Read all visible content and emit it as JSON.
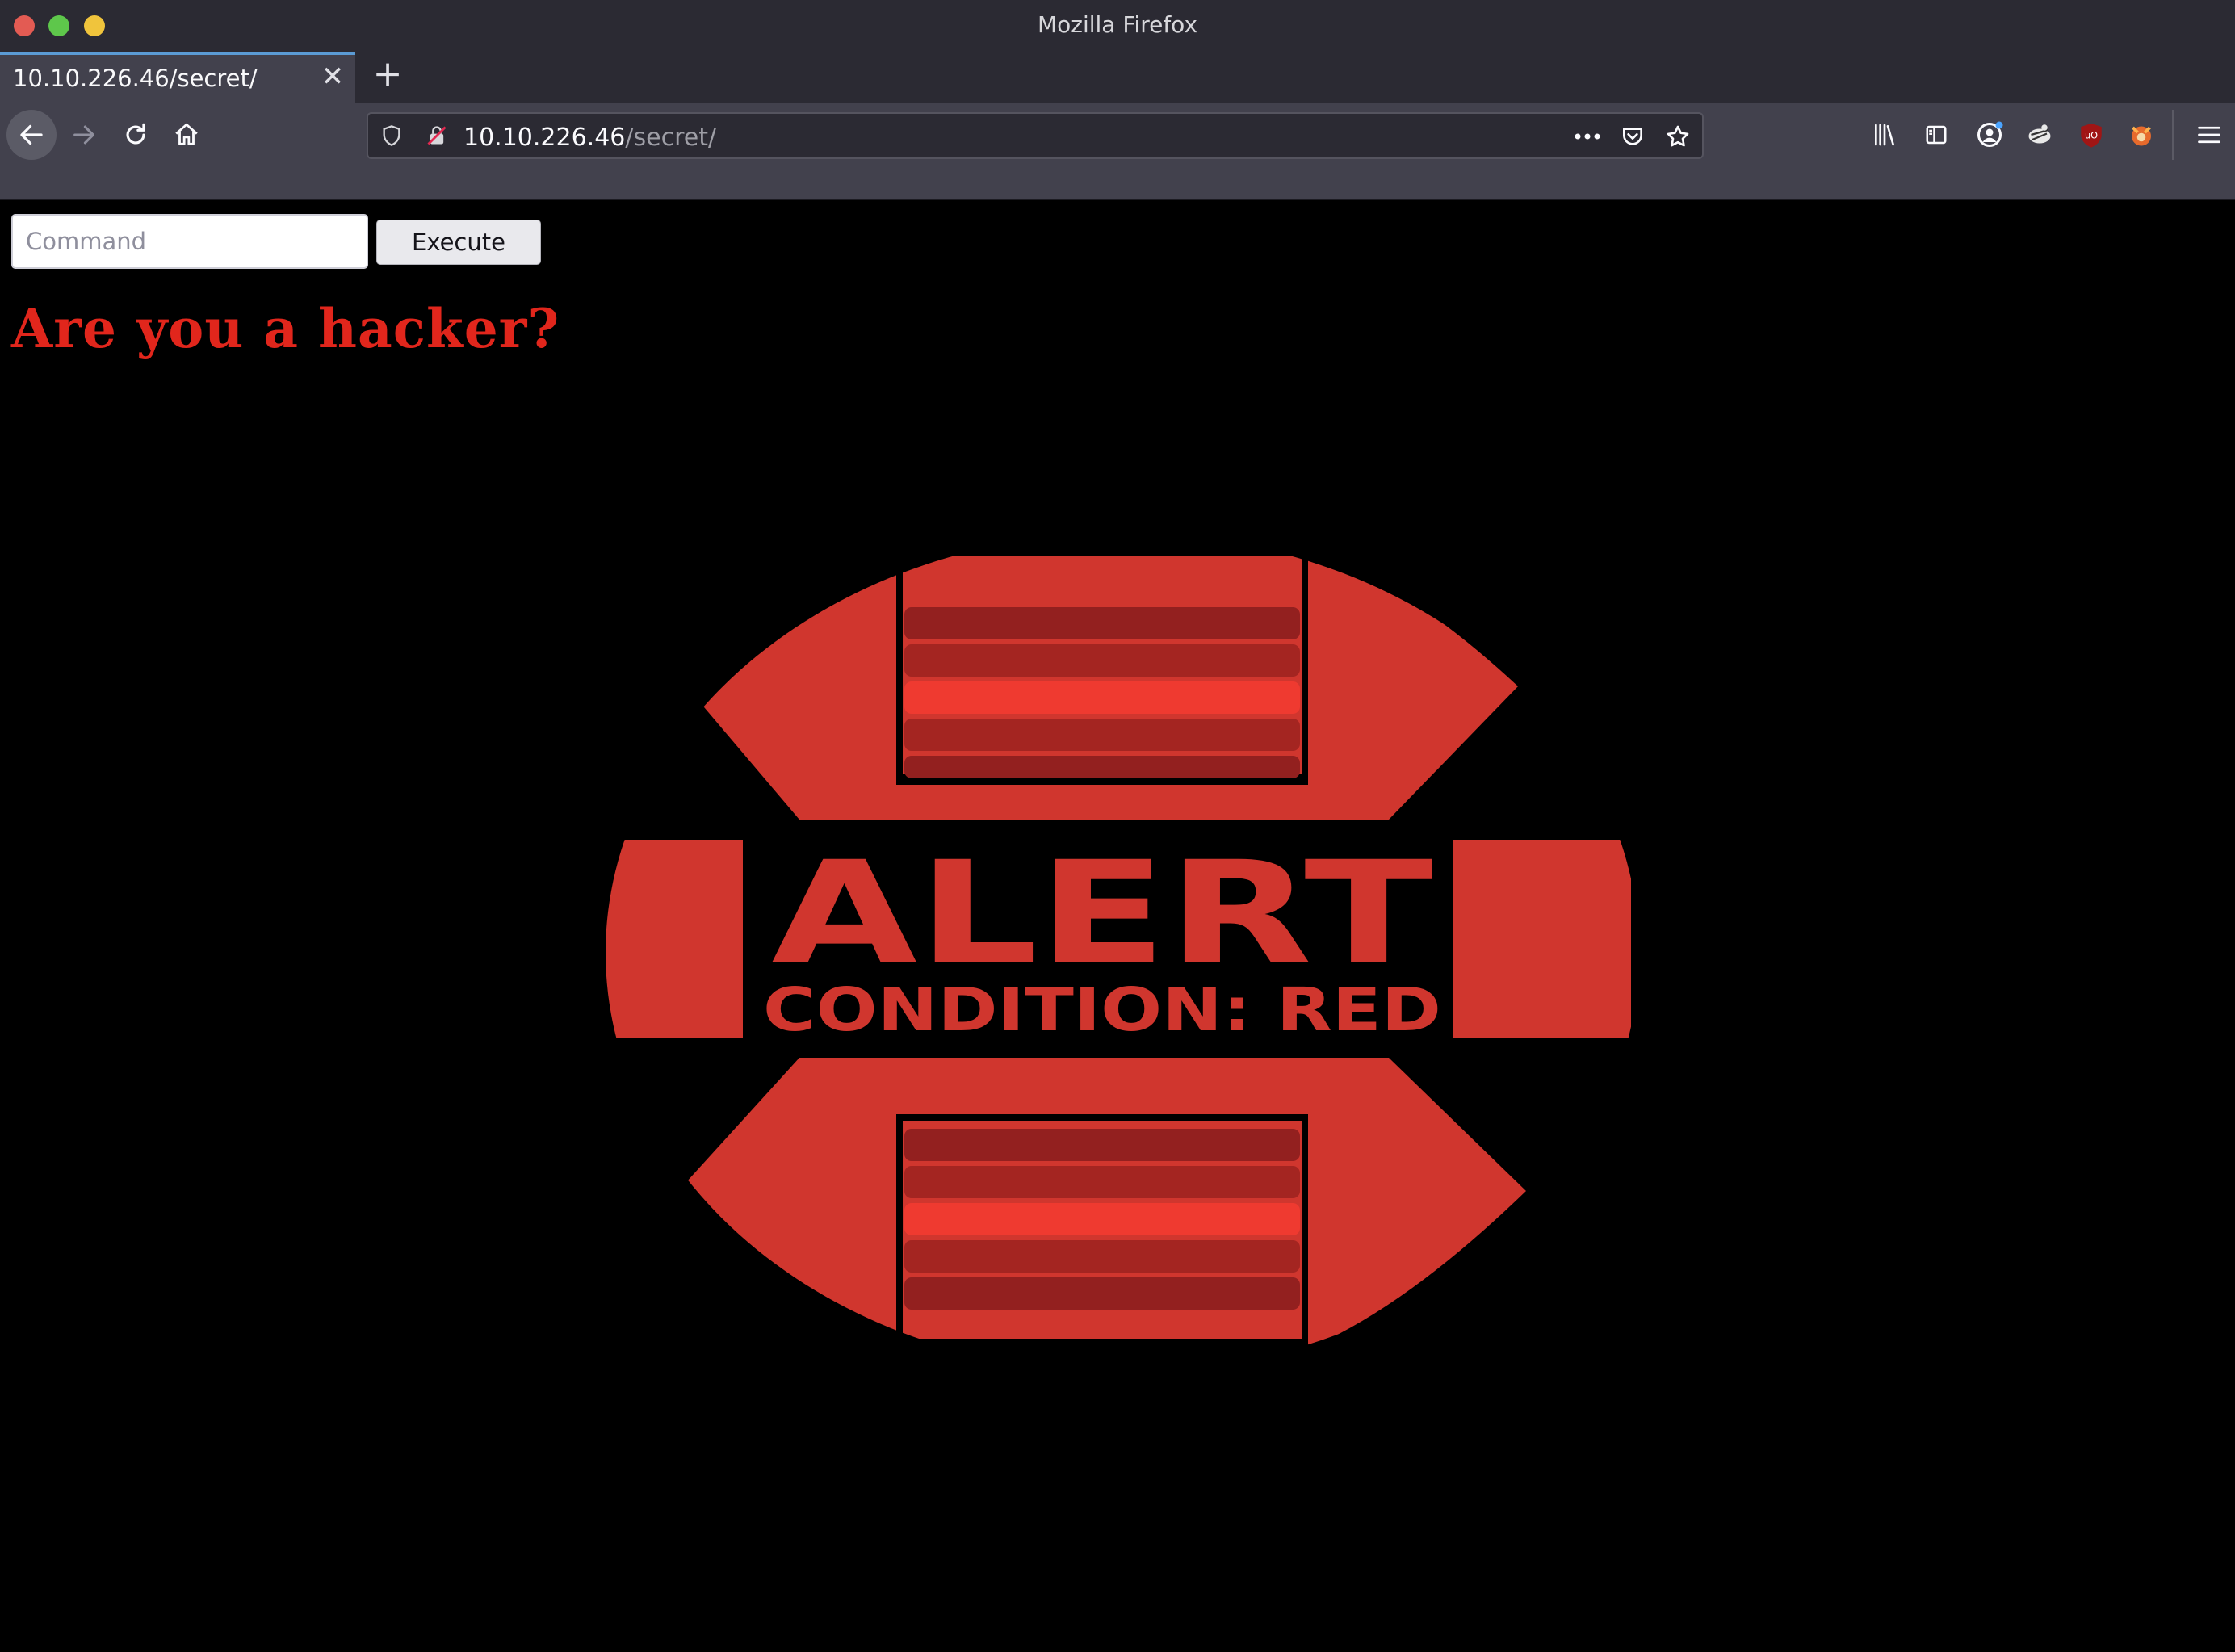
{
  "window": {
    "title": "Mozilla Firefox"
  },
  "tab": {
    "title": "10.10.226.46/secret/",
    "close_icon": "close-icon",
    "new_tab_icon": "plus-icon"
  },
  "navbar": {
    "url_host": "10.10.226.46",
    "url_path": "/secret/",
    "icons": [
      "back-arrow-icon",
      "forward-arrow-icon",
      "reload-icon",
      "home-icon",
      "shield-icon",
      "insecure-lock-icon",
      "more-dots-icon",
      "pocket-icon",
      "bookmark-star-icon",
      "library-icon",
      "sidebar-icon",
      "account-icon",
      "extension-icon",
      "ublock-icon",
      "fox-extension-icon",
      "hamburger-menu-icon"
    ]
  },
  "page": {
    "command_placeholder": "Command",
    "execute_label": "Execute",
    "heading": "Are you a hacker?",
    "logo": {
      "line1": "ALERT",
      "line2": "CONDITION: RED"
    }
  },
  "colors": {
    "alert_red": "#d0362e",
    "stripe_dark": "#93201f",
    "heading_red": "#e1261c",
    "page_bg": "#000000"
  }
}
